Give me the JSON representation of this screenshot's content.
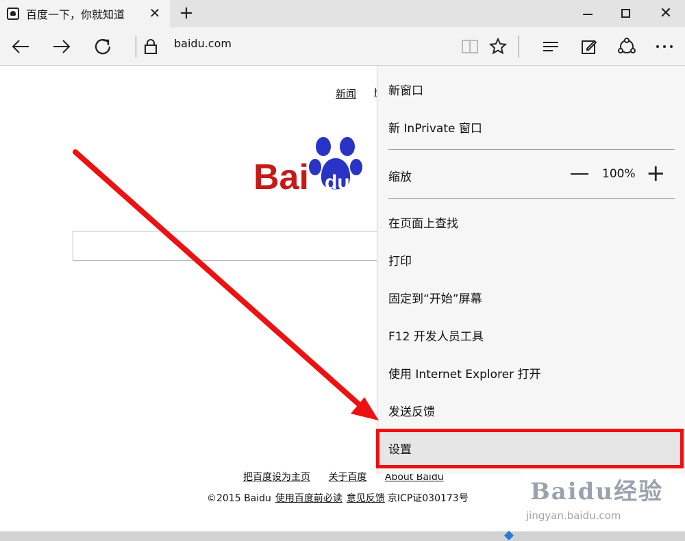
{
  "tab": {
    "title": "百度一下，你就知道",
    "close_glyph": "✕",
    "new_tab_glyph": "+"
  },
  "window": {
    "close_glyph": "✕"
  },
  "address_bar": {
    "url": "baidu.com"
  },
  "page": {
    "news_link": "新闻",
    "news_link_partial": "h",
    "logo_text_left": "Bai",
    "logo_text_paw": "du",
    "footer_links": [
      "把百度设为主页",
      "关于百度",
      "About  Baidu"
    ],
    "copyright_text": "©2015 Baidu",
    "copyright_link_1": "使用百度前必读",
    "copyright_link_2": "意见反馈",
    "copyright_icp": "京ICP证030173号"
  },
  "menu": {
    "new_window": "新窗口",
    "new_inprivate": "新 InPrivate 窗口",
    "zoom_label": "缩放",
    "zoom_value": "100%",
    "zoom_plus_glyph": "+",
    "find_on_page": "在页面上查找",
    "print": "打印",
    "pin_to_start": "固定到“开始”屏幕",
    "f12_tools": "F12 开发人员工具",
    "open_with_ie": "使用 Internet Explorer 打开",
    "send_feedback": "发送反馈",
    "settings": "设置"
  },
  "watermark": {
    "title": "Baidu经验",
    "url": "jingyan.baidu.com"
  },
  "colors": {
    "annotation_red": "#ee1111",
    "baidu_red": "#c41a1a",
    "baidu_blue": "#2933c6"
  }
}
